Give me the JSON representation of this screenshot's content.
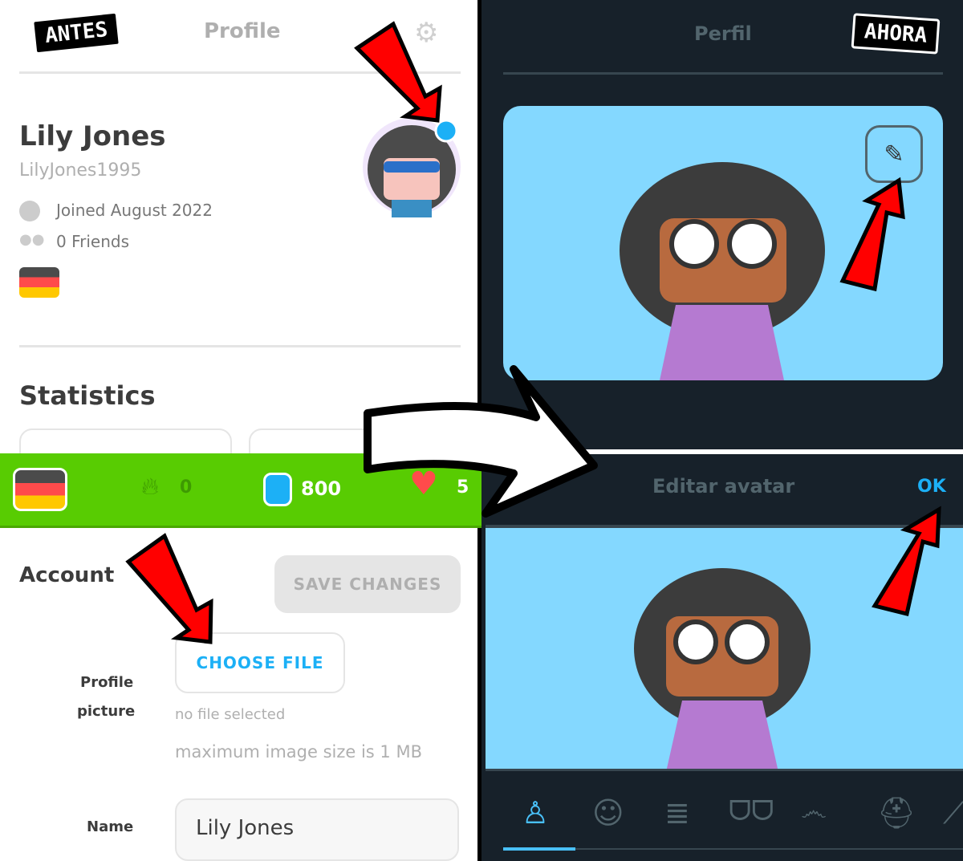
{
  "before": {
    "badge": "ANTES",
    "header_title": "Profile",
    "name": "Lily Jones",
    "username": "LilyJones1995",
    "joined": "Joined August 2022",
    "friends": "0 Friends",
    "statistics": "Statistics",
    "streak": "0",
    "gems": "800",
    "hearts": "5",
    "account": "Account",
    "save_changes": "SAVE CHANGES",
    "profile_picture_label": "Profile\npicture",
    "profile_picture_line1": "Profile",
    "profile_picture_line2": "picture",
    "choose_file": "CHOOSE FILE",
    "no_file": "no file selected",
    "max_size": "maximum image size is 1 MB",
    "name_label": "Name",
    "name_value": "Lily Jones"
  },
  "after": {
    "badge": "AHORA",
    "header_title": "Perfil",
    "edit_title": "Editar avatar",
    "ok": "OK",
    "tabs": [
      "body-icon",
      "face-icon",
      "comb-icon",
      "glasses-icon",
      "mustache-icon",
      "beanie-icon",
      "brush-icon"
    ]
  },
  "colors": {
    "accent_blue": "#1cb0f6",
    "green_bar": "#58cc02",
    "avatar_bg": "#84d8ff",
    "dark_bg": "#17212a",
    "arrow_red": "#ff0000"
  }
}
